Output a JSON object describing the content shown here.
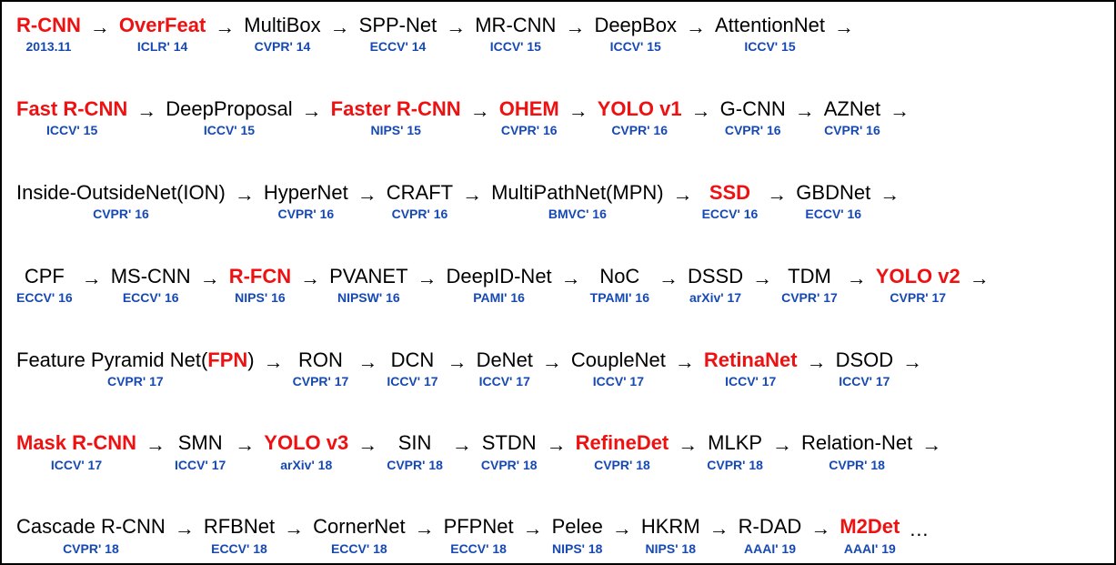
{
  "chart_data": {
    "type": "flow",
    "description": "Timeline / flowchart of object detection papers. Each node has a model name and publication venue/date. Highlighted nodes are emphasized (red bold). Arrows link consecutive nodes left-to-right and continue to the next row.",
    "rows": [
      [
        {
          "name": "R-CNN",
          "venue": "2013.11",
          "highlight": true
        },
        {
          "name": "OverFeat",
          "venue": "ICLR' 14",
          "highlight": true
        },
        {
          "name": "MultiBox",
          "venue": "CVPR' 14"
        },
        {
          "name": "SPP-Net",
          "venue": "ECCV' 14"
        },
        {
          "name": "MR-CNN",
          "venue": "ICCV' 15"
        },
        {
          "name": "DeepBox",
          "venue": "ICCV' 15"
        },
        {
          "name": "AttentionNet",
          "venue": "ICCV' 15"
        }
      ],
      [
        {
          "name": "Fast R-CNN",
          "venue": "ICCV' 15",
          "highlight": true
        },
        {
          "name": "DeepProposal",
          "venue": "ICCV' 15"
        },
        {
          "name": "Faster R-CNN",
          "venue": "NIPS' 15",
          "highlight": true
        },
        {
          "name": "OHEM",
          "venue": "CVPR' 16",
          "highlight": true
        },
        {
          "name": "YOLO v1",
          "venue": "CVPR' 16",
          "highlight": true
        },
        {
          "name": "G-CNN",
          "venue": "CVPR' 16"
        },
        {
          "name": "AZNet",
          "venue": "CVPR' 16"
        }
      ],
      [
        {
          "name": "Inside-OutsideNet(ION)",
          "venue": "CVPR' 16"
        },
        {
          "name": "HyperNet",
          "venue": "CVPR' 16"
        },
        {
          "name": "CRAFT",
          "venue": "CVPR' 16"
        },
        {
          "name": "MultiPathNet(MPN)",
          "venue": "BMVC' 16"
        },
        {
          "name": "SSD",
          "venue": "ECCV' 16",
          "highlight": true
        },
        {
          "name": "GBDNet",
          "venue": "ECCV' 16"
        }
      ],
      [
        {
          "name": "CPF",
          "venue": "ECCV' 16"
        },
        {
          "name": "MS-CNN",
          "venue": "ECCV' 16"
        },
        {
          "name": "R-FCN",
          "venue": "NIPS' 16",
          "highlight": true
        },
        {
          "name": "PVANET",
          "venue": "NIPSW' 16"
        },
        {
          "name": "DeepID-Net",
          "venue": "PAMI' 16"
        },
        {
          "name": "NoC",
          "venue": "TPAMI' 16"
        },
        {
          "name": "DSSD",
          "venue": "arXiv' 17"
        },
        {
          "name": "TDM",
          "venue": "CVPR' 17"
        },
        {
          "name": "YOLO v2",
          "venue": "CVPR' 17",
          "highlight": true
        }
      ],
      [
        {
          "name": "Feature Pyramid Net(FPN)",
          "venue": "CVPR' 17",
          "highlight_token": "FPN"
        },
        {
          "name": "RON",
          "venue": "CVPR' 17"
        },
        {
          "name": "DCN",
          "venue": "ICCV' 17"
        },
        {
          "name": "DeNet",
          "venue": "ICCV' 17"
        },
        {
          "name": "CoupleNet",
          "venue": "ICCV' 17"
        },
        {
          "name": "RetinaNet",
          "venue": "ICCV' 17",
          "highlight": true
        },
        {
          "name": "DSOD",
          "venue": "ICCV' 17"
        }
      ],
      [
        {
          "name": "Mask R-CNN",
          "venue": "ICCV' 17",
          "highlight": true
        },
        {
          "name": "SMN",
          "venue": "ICCV' 17"
        },
        {
          "name": "YOLO v3",
          "venue": "arXiv' 18",
          "highlight": true
        },
        {
          "name": "SIN",
          "venue": "CVPR' 18"
        },
        {
          "name": "STDN",
          "venue": "CVPR' 18"
        },
        {
          "name": "RefineDet",
          "venue": "CVPR' 18",
          "highlight": true
        },
        {
          "name": "MLKP",
          "venue": "CVPR' 18"
        },
        {
          "name": "Relation-Net",
          "venue": "CVPR' 18"
        }
      ],
      [
        {
          "name": "Cascade R-CNN",
          "venue": "CVPR' 18"
        },
        {
          "name": "RFBNet",
          "venue": "ECCV' 18"
        },
        {
          "name": "CornerNet",
          "venue": "ECCV' 18"
        },
        {
          "name": "PFPNet",
          "venue": "ECCV' 18"
        },
        {
          "name": "Pelee",
          "venue": "NIPS' 18"
        },
        {
          "name": "HKRM",
          "venue": "NIPS' 18"
        },
        {
          "name": "R-DAD",
          "venue": "AAAI' 19"
        },
        {
          "name": "M2Det",
          "venue": "AAAI' 19",
          "highlight": true,
          "trailing": "ellipsis"
        }
      ]
    ]
  }
}
